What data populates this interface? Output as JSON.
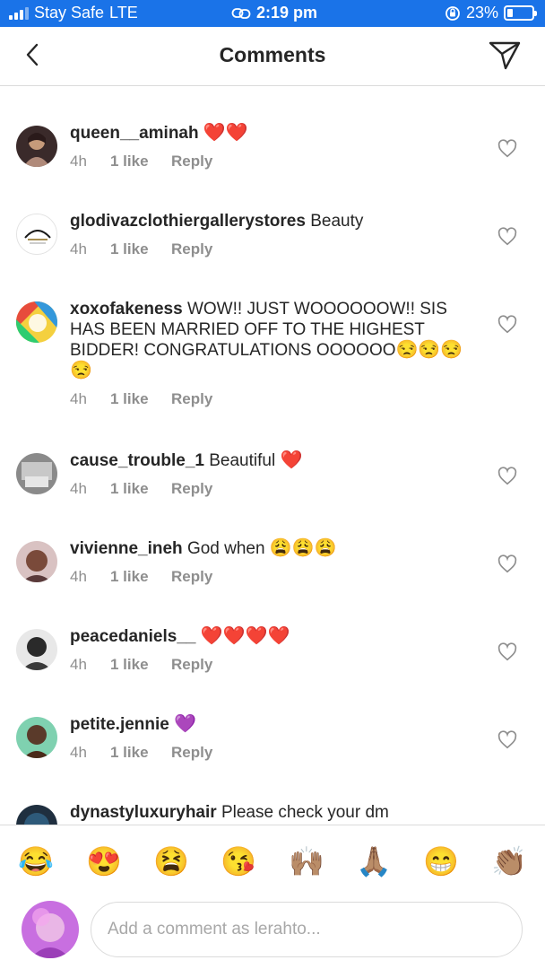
{
  "status_bar": {
    "carrier": "Stay Safe",
    "network": "LTE",
    "time": "2:19 pm",
    "battery": "23%",
    "battery_level": 0.23
  },
  "header": {
    "title": "Comments"
  },
  "comments": [
    {
      "username": "queen__aminah",
      "text": "",
      "emoji": "❤️❤️",
      "time": "4h",
      "likes": "1 like",
      "reply": "Reply"
    },
    {
      "username": "glodivazclothiergallerystores",
      "text": "Beauty",
      "emoji": "",
      "time": "4h",
      "likes": "1 like",
      "reply": "Reply"
    },
    {
      "username": "xoxofakeness",
      "text": "WOW!! JUST WOOOOOOW!! SIS HAS BEEN MARRIED OFF TO THE HIGHEST BIDDER! CONGRATULATIONS OOOOOO",
      "emoji": "😒😒😒😒",
      "time": "4h",
      "likes": "1 like",
      "reply": "Reply"
    },
    {
      "username": "cause_trouble_1",
      "text": "Beautiful",
      "emoji": "❤️",
      "time": "4h",
      "likes": "1 like",
      "reply": "Reply"
    },
    {
      "username": "vivienne_ineh",
      "text": "God when",
      "emoji": "😩😩😩",
      "time": "4h",
      "likes": "1 like",
      "reply": "Reply"
    },
    {
      "username": "peacedaniels__",
      "text": "",
      "emoji": "❤️❤️❤️❤️",
      "time": "4h",
      "likes": "1 like",
      "reply": "Reply"
    },
    {
      "username": "petite.jennie",
      "text": "",
      "emoji": "💜",
      "time": "4h",
      "likes": "1 like",
      "reply": "Reply"
    },
    {
      "username": "dynastyluxuryhair",
      "text": "Please check your dm",
      "emoji": "",
      "time": "",
      "likes": "",
      "reply": ""
    }
  ],
  "emoji_bar": [
    "😂",
    "😍",
    "😫",
    "😘",
    "🙌🏽",
    "🙏🏽",
    "😁",
    "👏🏽"
  ],
  "input": {
    "placeholder": "Add a comment as lerahto..."
  },
  "colors": {
    "status_bar": "#1a73e8",
    "text": "#262626",
    "secondary": "#8e8e8e",
    "divider": "#dbdbdb"
  }
}
